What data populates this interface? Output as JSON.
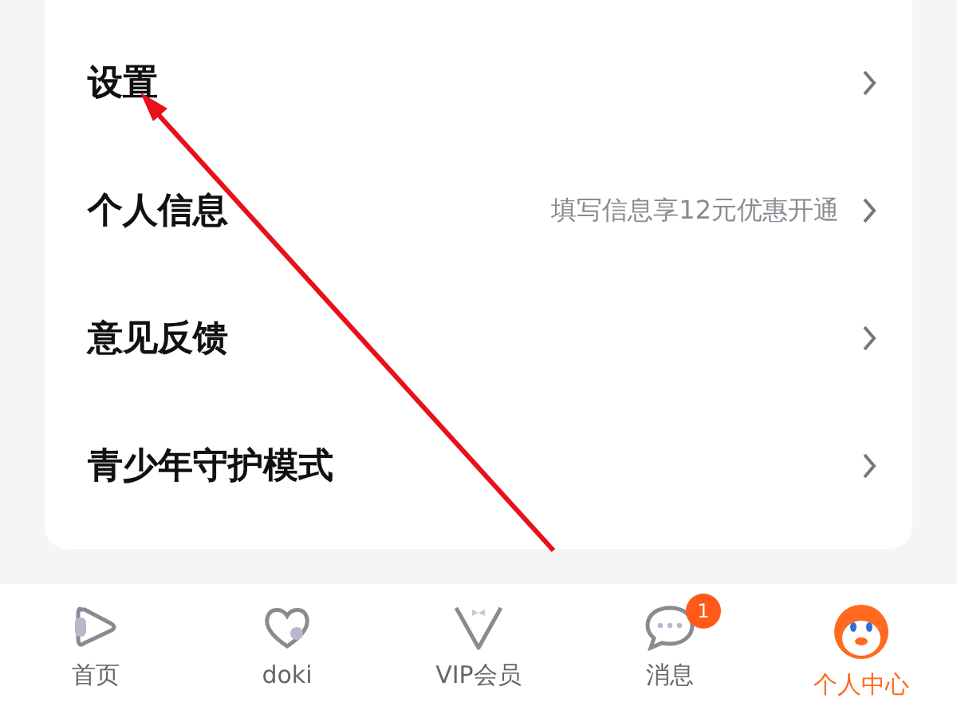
{
  "menu": [
    {
      "label": "设置"
    },
    {
      "label": "个人信息",
      "hint": "填写信息享12元优惠开通"
    },
    {
      "label": "意见反馈"
    },
    {
      "label": "青少年守护模式"
    }
  ],
  "tab_bar": [
    {
      "kind": "play",
      "label": "首页",
      "selected": false
    },
    {
      "kind": "heart",
      "label": "doki",
      "selected": false
    },
    {
      "kind": "vip",
      "label": "VIP会员",
      "selected": false
    },
    {
      "kind": "chat",
      "label": "消息",
      "badge": "1",
      "selected": false
    },
    {
      "kind": "avatar",
      "label": "个人中心",
      "selected": true
    }
  ]
}
